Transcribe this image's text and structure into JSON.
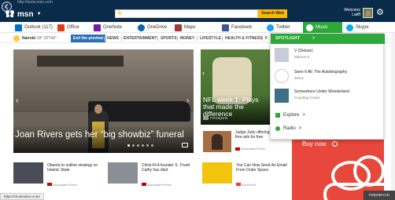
{
  "browser": {
    "url": "http://www.msn.com"
  },
  "header": {
    "logo_text": "msn",
    "search_placeholder": "",
    "bing_label": "b",
    "search_button": "Search Web",
    "welcome_label": "Welcome",
    "user_name": "Latiff"
  },
  "apps": [
    {
      "label": "Outlook (117)",
      "icon": "outlook-icon",
      "color": "#0072c6"
    },
    {
      "label": "Office",
      "icon": "office-icon",
      "color": "#dc3e15"
    },
    {
      "label": "OneNote",
      "icon": "onenote-icon",
      "color": "#7719aa"
    },
    {
      "label": "OneDrive",
      "icon": "onedrive-icon",
      "color": "#0a64ad"
    },
    {
      "label": "Maps",
      "icon": "maps-icon",
      "color": "#a4373a"
    },
    {
      "label": "Facebook",
      "icon": "facebook-icon",
      "color": "#3b5998"
    },
    {
      "label": "Twitter",
      "icon": "twitter-icon",
      "color": "#1da1f2"
    },
    {
      "label": "Music",
      "icon": "xbox-music-icon",
      "color": "#2ea83a"
    },
    {
      "label": "Skype",
      "icon": "skype-icon",
      "color": "#00aff0"
    }
  ],
  "secondary_nav": {
    "location": "Nairobi",
    "temp_high": "19°",
    "temp_low": "22°/16°",
    "exit_preview": "Exit the preview",
    "categories": [
      "NEWS",
      "ENTERTAINMENT",
      "SPORTS",
      "MONEY",
      "LIFESTYLE",
      "HEALTH & FITNESS",
      "F"
    ]
  },
  "spotlight": {
    "heading": "SPOTLIGHT",
    "chevron": ">",
    "tracks": [
      {
        "title": "V (Deluxe)",
        "artist": "Maroon 5",
        "thumb_color": "#c8ccd6"
      },
      {
        "title": "Seen It All: The Autobiography",
        "artist": "Jeezy",
        "thumb_color": "#ffffff"
      },
      {
        "title": "Somewhere Under Wonderland",
        "artist": "Counting Crows",
        "thumb_color": "#3f6f86"
      }
    ],
    "links": [
      {
        "label": "Explore",
        "chevron": ">"
      },
      {
        "label": "Radio",
        "chevron": ">"
      }
    ]
  },
  "hero": {
    "caption": "Joan Rivers gets her “big showbiz” funeral",
    "left_arrow": "‹",
    "right_arrow": "›"
  },
  "side_story": {
    "title": "NFL week 1: Plays that made the difference",
    "source": "FOXSports",
    "left_arrow": "‹"
  },
  "judge_story": {
    "title": "Judge Judy offering free ads for free",
    "source": "Associated Press"
  },
  "ad": {
    "label": "Buy now",
    "accent": "#e8473b"
  },
  "news_row": [
    {
      "title": "Obama to outline strategy on Islamic State",
      "source": "Associated Press",
      "thumb": "#4a4d57",
      "src_color": "#c00"
    },
    {
      "title": "Chick-fil-A founder S. Truett Cathy has died",
      "source": "Associated Press",
      "thumb": "#8a8f95",
      "src_color": "#c00"
    },
    {
      "title": "You Can Now Send An Email From Outer Space",
      "source": "BuzzFeed",
      "thumb": "#f1c50d",
      "src_color": "#e6412a"
    }
  ],
  "status_url": "https://musicxbox.com/",
  "feedback": "FEEDBACK"
}
